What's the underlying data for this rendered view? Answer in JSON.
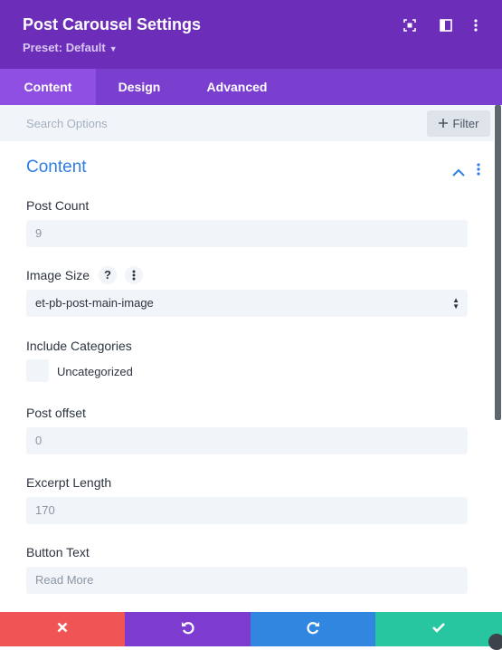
{
  "header": {
    "title": "Post Carousel Settings",
    "preset": "Preset: Default",
    "icons": [
      "expand-icon",
      "split-view-icon",
      "more-vertical-icon"
    ]
  },
  "tabs": [
    {
      "label": "Content",
      "active": true
    },
    {
      "label": "Design",
      "active": false
    },
    {
      "label": "Advanced",
      "active": false
    }
  ],
  "search": {
    "placeholder": "Search Options",
    "filter_label": "Filter"
  },
  "section": {
    "title": "Content"
  },
  "fields": {
    "post_count": {
      "label": "Post Count",
      "value": "9"
    },
    "image_size": {
      "label": "Image Size",
      "help": "?",
      "value": "et-pb-post-main-image"
    },
    "include_categories": {
      "label": "Include Categories",
      "option": "Uncategorized",
      "checked": false
    },
    "post_offset": {
      "label": "Post offset",
      "value": "0"
    },
    "excerpt_length": {
      "label": "Excerpt Length",
      "value": "170"
    },
    "button_text": {
      "label": "Button Text",
      "value": "Read More"
    }
  },
  "footer": {
    "buttons": [
      {
        "name": "cancel",
        "icon": "close-icon",
        "color": "#ef5555"
      },
      {
        "name": "undo",
        "icon": "undo-icon",
        "color": "#7e3bd0"
      },
      {
        "name": "redo",
        "icon": "redo-icon",
        "color": "#3187e0"
      },
      {
        "name": "save",
        "icon": "check-icon",
        "color": "#28c6a0"
      }
    ]
  },
  "colors": {
    "header": "#6c2eb9",
    "tabs": "#7b3fd0",
    "active_tab": "#8e4fe2",
    "accent": "#2f7de1",
    "field_bg": "#f1f4f8"
  }
}
